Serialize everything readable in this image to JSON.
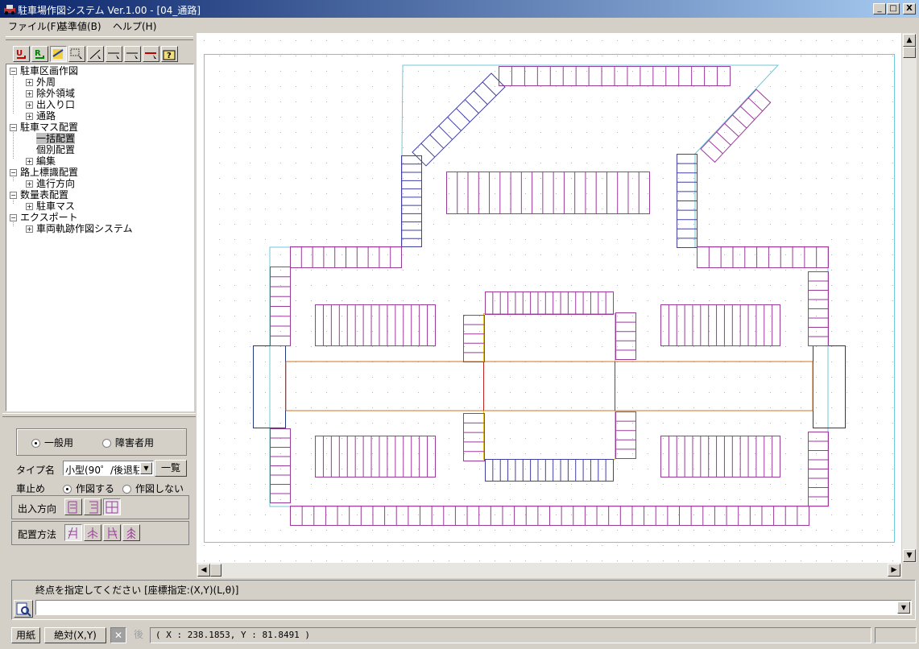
{
  "window": {
    "title": "駐車場作図システム Ver.1.00 - [04_通路]",
    "minimize": "_",
    "maximize": "□",
    "close": "X"
  },
  "menu": [
    {
      "label": "ファイル(F)"
    },
    {
      "label": "基準値(B)"
    },
    {
      "label": "ヘルプ(H)"
    }
  ],
  "toolbar": [
    "undo-icon",
    "redo-icon",
    "draw-icon",
    "select-icon",
    "line-icon",
    "dim-icon",
    "dim2-icon",
    "dim3-icon",
    "help-icon"
  ],
  "tree": [
    {
      "label": "駐車区画作図",
      "level": 0,
      "exp": "−"
    },
    {
      "label": "外周",
      "level": 1,
      "exp": "+"
    },
    {
      "label": "除外領域",
      "level": 1,
      "exp": "+"
    },
    {
      "label": "出入り口",
      "level": 1,
      "exp": "+"
    },
    {
      "label": "通路",
      "level": 1,
      "exp": "+"
    },
    {
      "label": "駐車マス配置",
      "level": 0,
      "exp": "−"
    },
    {
      "label": "一括配置",
      "level": 1,
      "exp": "",
      "selected": true
    },
    {
      "label": "個別配置",
      "level": 1,
      "exp": ""
    },
    {
      "label": "編集",
      "level": 1,
      "exp": "+"
    },
    {
      "label": "路上標識配置",
      "level": 0,
      "exp": "−"
    },
    {
      "label": "進行方向",
      "level": 1,
      "exp": "+"
    },
    {
      "label": "数量表配置",
      "level": 0,
      "exp": "−"
    },
    {
      "label": "駐車マス",
      "level": 1,
      "exp": "+"
    },
    {
      "label": "エクスポート",
      "level": 0,
      "exp": "−"
    },
    {
      "label": "車両軌跡作図システム",
      "level": 1,
      "exp": "+"
    }
  ],
  "controls": {
    "usage_general": "一般用",
    "usage_disabled": "障害者用",
    "type_label": "タイプ名",
    "type_value": "小型(90゜/後退駐",
    "list_button": "一覧",
    "stopper_label": "車止め",
    "stopper_draw": "作図する",
    "stopper_nodraw": "作図しない",
    "direction_label": "出入方向",
    "method_label": "配置方法"
  },
  "command": {
    "prompt": "終点を指定してください [座標指定:(X,Y)(L,θ)]",
    "input_value": ""
  },
  "status": {
    "paper": "用紙",
    "abs": "絶対(X,Y)",
    "cancel": "✕",
    "back": "後",
    "coords": "( X : 238.1853, Y : 81.8491 )"
  },
  "colors": {
    "title_start": "#0a246a",
    "title_end": "#a6caf0",
    "border_cyan": "#6fc8d8",
    "stall_blue": "#4040a0",
    "stall_purple": "#9a3a9a",
    "aisle_orange": "#d07020",
    "aisle_red": "#c02020",
    "island_yellow": "#e0c020",
    "gate_navy": "#203880"
  }
}
